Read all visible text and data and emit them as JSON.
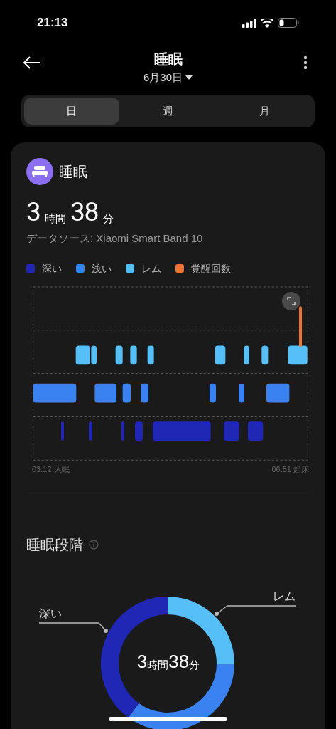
{
  "status_bar": {
    "time": "21:13"
  },
  "header": {
    "title": "睡眠",
    "date": "6月30日"
  },
  "tabs": [
    {
      "label": "日",
      "selected": true
    },
    {
      "label": "週",
      "selected": false
    },
    {
      "label": "月",
      "selected": false
    }
  ],
  "summary": {
    "title": "睡眠",
    "hours": "3",
    "hours_unit": "時間",
    "minutes": "38",
    "minutes_unit": "分",
    "source": "データソース: Xiaomi Smart Band 10"
  },
  "legend": [
    {
      "label": "深い",
      "color": "#2127b5"
    },
    {
      "label": "浅い",
      "color": "#3a82f0"
    },
    {
      "label": "レム",
      "color": "#56bff7"
    },
    {
      "label": "覚醒回数",
      "color": "#ef7436"
    }
  ],
  "hypnogram": {
    "start": "03:12 入眠",
    "end": "06:51 起床"
  },
  "stages": {
    "title": "睡眠段階",
    "left_label": "深い",
    "right_label": "レム",
    "hours": "3",
    "hours_unit": "時間",
    "minutes": "38",
    "minutes_unit": "分"
  }
}
